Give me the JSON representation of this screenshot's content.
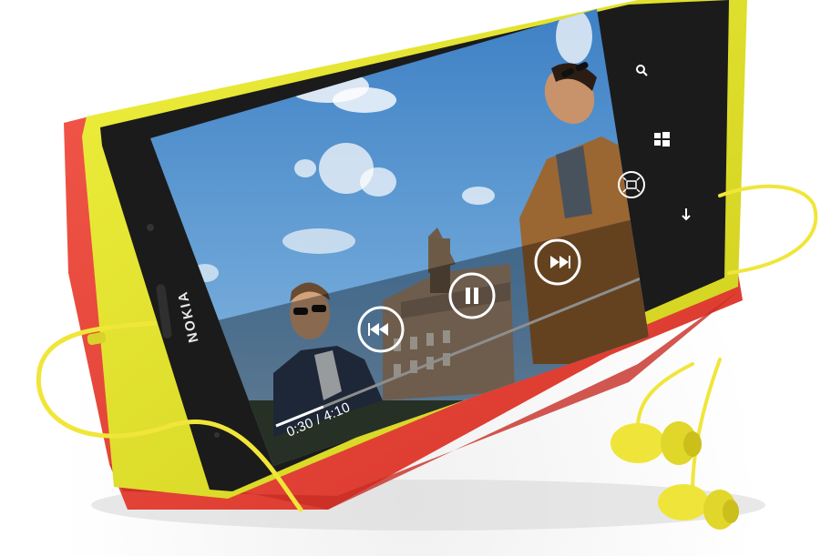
{
  "brand": "NOKIA",
  "player": {
    "time_display": "0:30 / 4:10",
    "progress_fraction": 0.12,
    "controls": {
      "rewind": "rewind-icon",
      "pause": "pause-icon",
      "fast_forward": "fast-forward-icon"
    }
  },
  "phone_buttons": {
    "search": "search-icon",
    "start": "windows-start-icon",
    "back": "back-arrow-icon"
  },
  "colors": {
    "phone_body": "#e3e22a",
    "cover": "#e8433a",
    "earphones": "#f0e63a",
    "screen_bezel": "#1b1b1b"
  }
}
